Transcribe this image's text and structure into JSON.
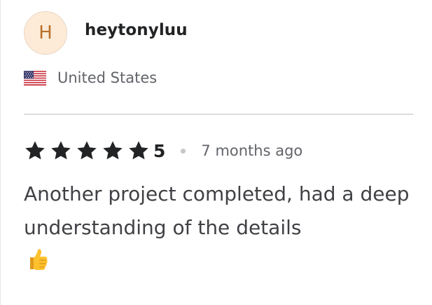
{
  "reviewer": {
    "avatar_initial": "H",
    "username": "heytonyluu",
    "country": "United States",
    "flag_icon": "us-flag-icon"
  },
  "review": {
    "rating_value": "5",
    "stars": 5,
    "stars_max": 5,
    "time_ago": "7 months ago",
    "text": "Another project completed, had a deep understanding of the details",
    "trailing_emoji_icon": "thumbs-up-icon"
  },
  "colors": {
    "avatar_bg": "#fdebd7",
    "avatar_text": "#b8702c",
    "star": "#222325",
    "divider": "#dadbdd",
    "muted_text": "#62646a"
  }
}
